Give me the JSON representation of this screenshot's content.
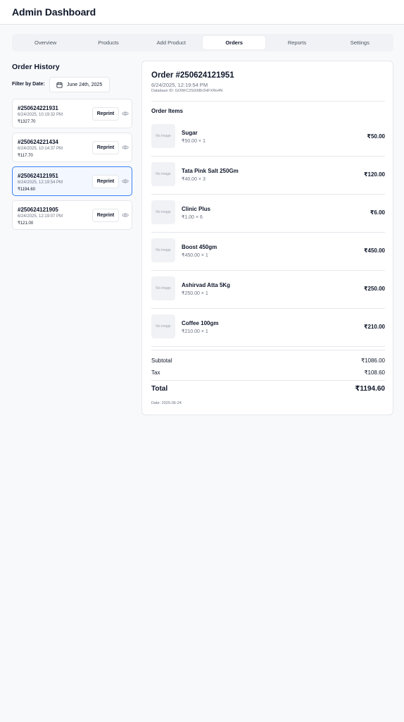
{
  "app": {
    "title": "Admin Dashboard"
  },
  "tabs": [
    {
      "label": "Overview",
      "active": false
    },
    {
      "label": "Products",
      "active": false
    },
    {
      "label": "Add Product",
      "active": false
    },
    {
      "label": "Orders",
      "active": true
    },
    {
      "label": "Reports",
      "active": false
    },
    {
      "label": "Settings",
      "active": false
    }
  ],
  "history": {
    "title": "Order History",
    "filter_label": "Filter by Date:",
    "filter_date": "June 24th, 2025",
    "reprint_label": "Reprint",
    "orders": [
      {
        "id": "#250624221931",
        "datetime": "6/24/2025, 10:19:32 PM",
        "total": "₹1327.70",
        "selected": false
      },
      {
        "id": "#250624221434",
        "datetime": "6/24/2025, 10:14:37 PM",
        "total": "₹117.70",
        "selected": false
      },
      {
        "id": "#250624121951",
        "datetime": "6/24/2025, 12:19:54 PM",
        "total": "₹1194.60",
        "selected": true
      },
      {
        "id": "#250624121905",
        "datetime": "6/24/2025, 12:19:07 PM",
        "total": "₹121.00",
        "selected": false
      }
    ]
  },
  "detail": {
    "title": "Order #250624121951",
    "datetime": "6/24/2025, 12:19:54 PM",
    "database_id": "Database ID: GOWrC2SiS6Br2HFXRo4N",
    "items_title": "Order Items",
    "no_image_label": "No image",
    "items": [
      {
        "name": "Sugar",
        "qty": "₹50.00 × 1",
        "price": "₹50.00"
      },
      {
        "name": "Tata Pink Salt 250Gm",
        "qty": "₹40.00 × 3",
        "price": "₹120.00"
      },
      {
        "name": "Clinic Plus",
        "qty": "₹1.00 × 6",
        "price": "₹6.00"
      },
      {
        "name": "Boost 450gm",
        "qty": "₹450.00 × 1",
        "price": "₹450.00"
      },
      {
        "name": "Ashirvad Atta 5Kg",
        "qty": "₹250.00 × 1",
        "price": "₹250.00"
      },
      {
        "name": "Coffee 100gm",
        "qty": "₹210.00 × 1",
        "price": "₹210.00"
      }
    ],
    "subtotal_label": "Subtotal",
    "subtotal": "₹1086.00",
    "tax_label": "Tax",
    "tax": "₹108.60",
    "total_label": "Total",
    "total": "₹1194.60",
    "footer_date": "Date: 2025-06-24"
  }
}
